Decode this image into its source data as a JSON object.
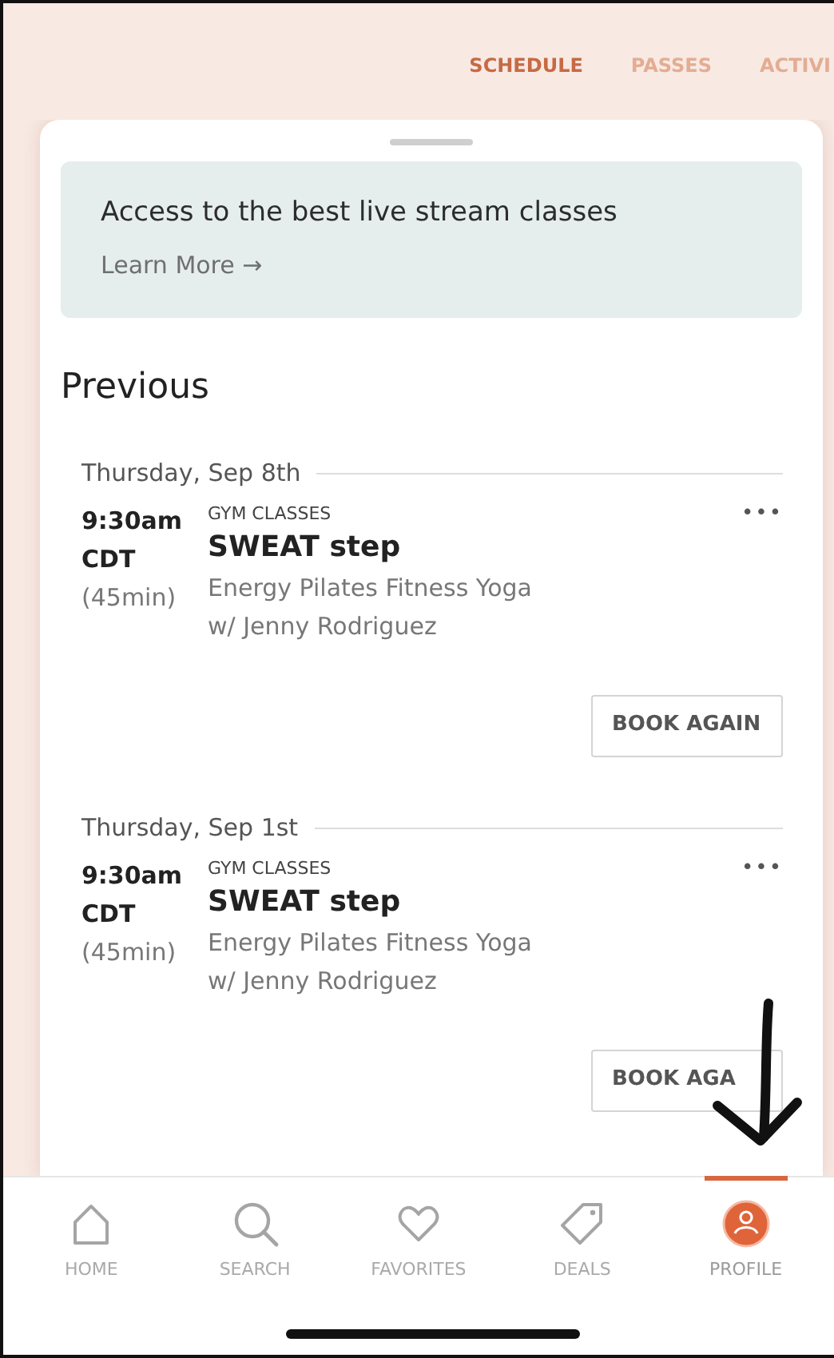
{
  "tabs": [
    {
      "label": "SCHEDULE",
      "selected": true
    },
    {
      "label": "PASSES",
      "selected": false
    },
    {
      "label": "ACTIVI",
      "selected": false
    }
  ],
  "banner": {
    "title": "Access to the best live stream classes",
    "link": "Learn More",
    "link_arrow": "→"
  },
  "section_title": "Previous",
  "sessions": [
    {
      "date": "Thursday, Sep 8th",
      "time": "9:30am",
      "timezone": "CDT",
      "duration": "(45min)",
      "category": "GYM CLASSES",
      "name": "SWEAT step",
      "studio": "Energy Pilates Fitness Yoga",
      "instructor": "w/ Jenny Rodriguez",
      "menu": "•••",
      "button": "BOOK AGAIN"
    },
    {
      "date": "Thursday, Sep 1st",
      "time": "9:30am",
      "timezone": "CDT",
      "duration": "(45min)",
      "category": "GYM CLASSES",
      "name": "SWEAT step",
      "studio": "Energy Pilates Fitness Yoga",
      "instructor": "w/ Jenny Rodriguez",
      "menu": "•••",
      "button": "BOOK AGA"
    }
  ],
  "bottom_nav": [
    {
      "kind": "home",
      "label": "HOME",
      "selected": false
    },
    {
      "kind": "search",
      "label": "SEARCH",
      "selected": false
    },
    {
      "kind": "favorites",
      "label": "FAVORITES",
      "selected": false
    },
    {
      "kind": "deals",
      "label": "DEALS",
      "selected": false
    },
    {
      "kind": "profile",
      "label": "PROFILE",
      "selected": true
    }
  ]
}
